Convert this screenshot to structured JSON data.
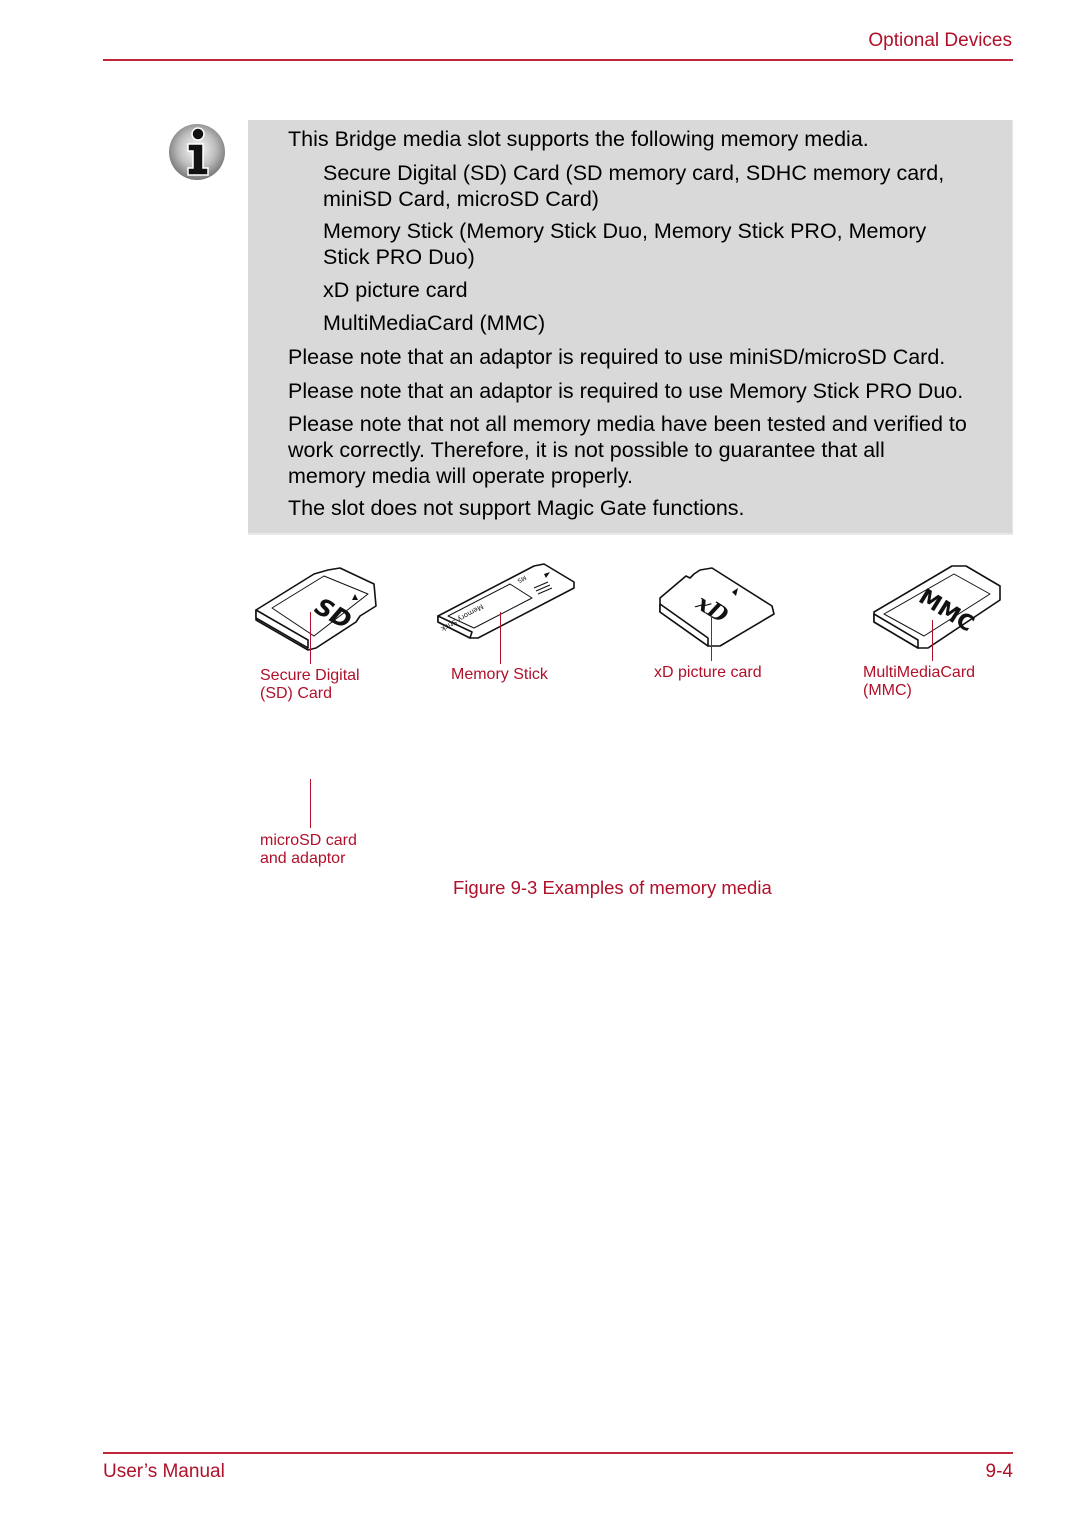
{
  "header": {
    "section_title": "Optional Devices"
  },
  "note": {
    "icon": "info-icon",
    "intro": "This Bridge media slot supports the following memory media.",
    "media_list": [
      [
        "Secure Digital (SD) Card (SD memory card, SDHC memory card,",
        "miniSD Card, microSD Card)"
      ],
      [
        "Memory Stick (Memory Stick Duo, Memory Stick PRO, Memory",
        "Stick PRO Duo)"
      ],
      [
        "xD picture card"
      ],
      [
        "MultiMediaCard (MMC)"
      ]
    ],
    "notes": [
      [
        "Please note that an adaptor is required to use miniSD/microSD Card."
      ],
      [
        "Please note that an adaptor is required to use Memory Stick PRO Duo."
      ],
      [
        "Please note that not all memory media have been tested and verified to",
        "work correctly. Therefore, it is not possible to guarantee that all",
        "memory media will operate properly."
      ],
      [
        "The slot does not support Magic Gate functions."
      ]
    ]
  },
  "figure": {
    "labels": {
      "sd": [
        "Secure Digital",
        "(SD) Card"
      ],
      "ms": [
        "Memory Stick"
      ],
      "xd": [
        "xD picture card"
      ],
      "mmc": [
        "MultiMediaCard",
        "(MMC)"
      ],
      "microsd": [
        "microSD card",
        "and adaptor"
      ]
    },
    "card_marks": {
      "sd": "SD",
      "ms": "Memory Stick",
      "ms_small": "MS",
      "xd": "xD",
      "mmc": "MMC"
    },
    "caption": "Figure 9-3 Examples of memory media"
  },
  "footer": {
    "left": "User’s Manual",
    "page": "9-4"
  },
  "colors": {
    "accent": "#b0102a",
    "note_bg": "#d9d9d9"
  }
}
